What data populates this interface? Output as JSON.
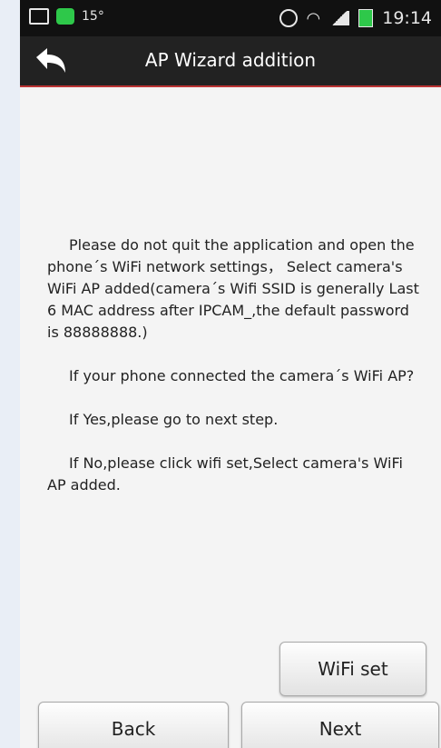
{
  "status_bar": {
    "temperature": "15°",
    "time": "19:14"
  },
  "header": {
    "title": "AP Wizard addition"
  },
  "instructions": [
    "Please do not quit the application and open the phone´s WiFi network settings， Select camera's WiFi AP added(camera´s Wifi SSID is generally Last 6 MAC address after IPCAM_,the default password is 88888888.)",
    "If your phone connected the camera´s WiFi AP?",
    "If Yes,please go to next step.",
    "If No,please click wifi set,Select camera's WiFi AP added."
  ],
  "buttons": {
    "wifi_set": "WiFi set",
    "back": "Back",
    "next": "Next"
  }
}
